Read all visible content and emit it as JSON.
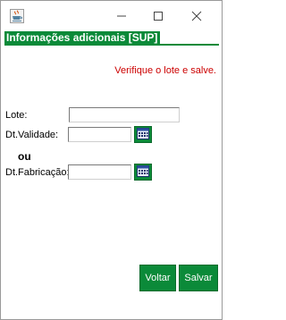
{
  "window": {
    "icon": "java-cup-icon",
    "controls": [
      "minimize-icon",
      "maximize-icon",
      "close-icon"
    ]
  },
  "header": {
    "title": "Informações adicionais [SUP]"
  },
  "warning": {
    "text": "Verifique o lote e salve."
  },
  "form": {
    "lote": {
      "label": "Lote:",
      "value": ""
    },
    "validade": {
      "label": "Dt.Validade:",
      "value": ""
    },
    "separator": "ou",
    "fabricacao": {
      "label": "Dt.Fabricação:",
      "value": ""
    }
  },
  "buttons": {
    "voltar": "Voltar",
    "salvar": "Salvar"
  },
  "colors": {
    "accent": "#0b8a39",
    "warning": "#cc0000"
  }
}
